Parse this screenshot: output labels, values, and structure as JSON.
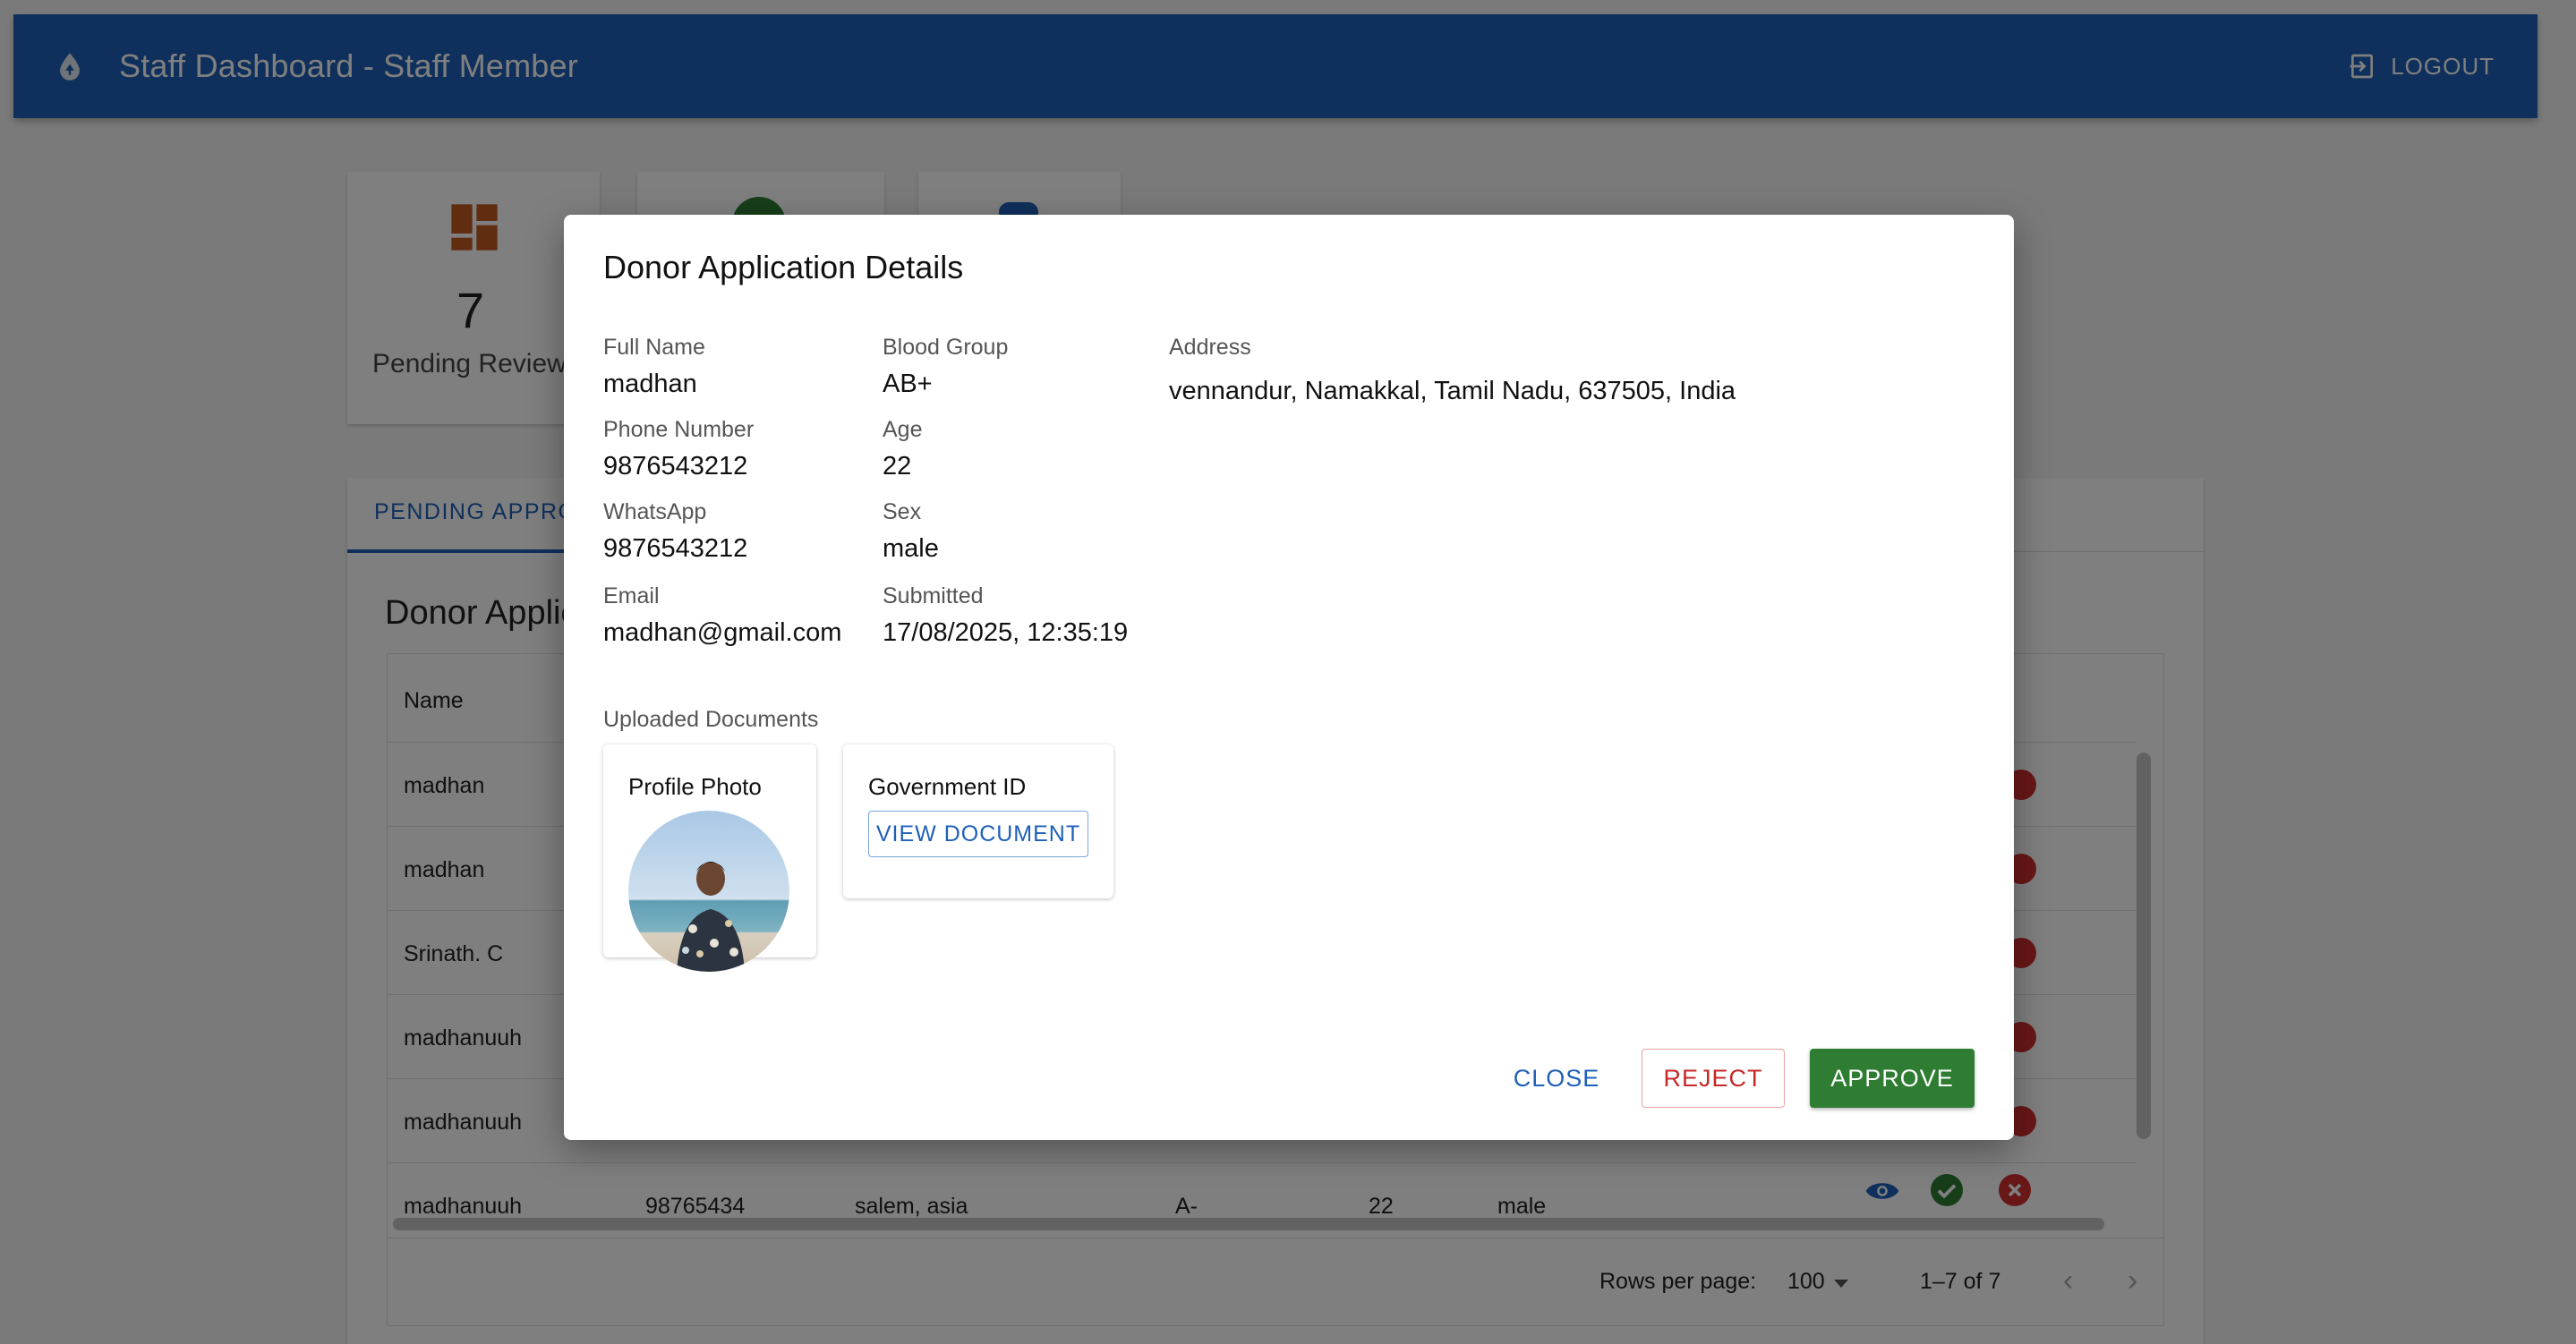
{
  "appbar": {
    "title": "Staff Dashboard - Staff Member",
    "logout_label": "LOGOUT"
  },
  "stats": [
    {
      "value": "7",
      "label": "Pending Reviews"
    }
  ],
  "tabs": [
    {
      "label": "PENDING APPROVALS"
    }
  ],
  "table": {
    "title": "Donor Applications",
    "headers": [
      "Name"
    ],
    "rows": [
      {
        "name": "madhan"
      },
      {
        "name": "madhan"
      },
      {
        "name": "Srinath. C"
      },
      {
        "name": "madhanuuh"
      },
      {
        "name": "madhanuuh"
      },
      {
        "name": "madhanuuh",
        "phone": "98765434",
        "address": "salem, asia",
        "blood_group": "A-",
        "age": "22",
        "sex": "male"
      }
    ],
    "footer": {
      "rows_per_page_label": "Rows per page:",
      "rows_per_page": "100",
      "range": "1–7 of 7"
    }
  },
  "dialog": {
    "title": "Donor Application Details",
    "fields": {
      "full_name": {
        "label": "Full Name",
        "value": "madhan"
      },
      "phone": {
        "label": "Phone Number",
        "value": "9876543212"
      },
      "whatsapp": {
        "label": "WhatsApp",
        "value": "9876543212"
      },
      "email": {
        "label": "Email",
        "value": "madhan@gmail.com"
      },
      "blood_group": {
        "label": "Blood Group",
        "value": "AB+"
      },
      "age": {
        "label": "Age",
        "value": "22"
      },
      "sex": {
        "label": "Sex",
        "value": "male"
      },
      "submitted": {
        "label": "Submitted",
        "value": "17/08/2025, 12:35:19"
      },
      "address": {
        "label": "Address",
        "value": "vennandur, Namakkal, Tamil Nadu, 637505, India"
      }
    },
    "documents_label": "Uploaded Documents",
    "documents": {
      "profile_photo": {
        "title": "Profile Photo"
      },
      "government_id": {
        "title": "Government ID",
        "button": "VIEW DOCUMENT"
      }
    },
    "actions": {
      "close": "CLOSE",
      "reject": "REJECT",
      "approve": "APPROVE"
    }
  },
  "colors": {
    "primary": "#1e60b8",
    "success": "#2e7d32",
    "danger": "#c62828"
  }
}
